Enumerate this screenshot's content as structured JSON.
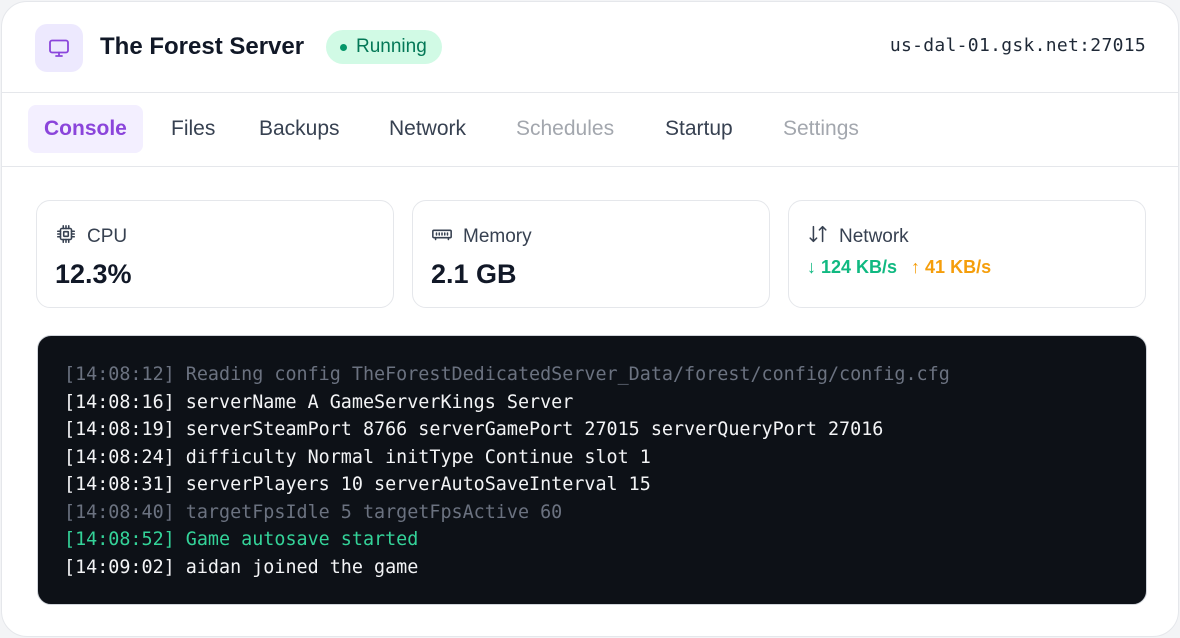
{
  "header": {
    "icon": "monitor-icon",
    "title": "The Forest Server",
    "status": "Running",
    "address": "us-dal-01.gsk.net:27015"
  },
  "tabs": [
    {
      "label": "Console",
      "state": "active"
    },
    {
      "label": "Files",
      "state": "normal"
    },
    {
      "label": "Backups",
      "state": "normal"
    },
    {
      "label": "Network",
      "state": "normal"
    },
    {
      "label": "Schedules",
      "state": "disabled"
    },
    {
      "label": "Startup",
      "state": "normal"
    },
    {
      "label": "Settings",
      "state": "disabled"
    }
  ],
  "stats": {
    "cpu": {
      "label": "CPU",
      "value": "12.3%",
      "icon": "cpu-icon"
    },
    "memory": {
      "label": "Memory",
      "value": "2.1 GB",
      "icon": "memory-icon"
    },
    "network": {
      "label": "Network",
      "icon": "arrows-up-down-icon",
      "down": "↓ 124 KB/s",
      "up": "↑ 41 KB/s"
    }
  },
  "console": {
    "lines": [
      {
        "text": "[14:08:12] Reading config TheForestDedicatedServer_Data/forest/config/config.cfg",
        "style": "dim"
      },
      {
        "text": "[14:08:16] serverName A GameServerKings Server",
        "style": "normal"
      },
      {
        "text": "[14:08:19] serverSteamPort 8766 serverGamePort 27015 serverQueryPort 27016",
        "style": "normal"
      },
      {
        "text": "[14:08:24] difficulty Normal initType Continue slot 1",
        "style": "normal"
      },
      {
        "text": "[14:08:31] serverPlayers 10 serverAutoSaveInterval 15",
        "style": "normal"
      },
      {
        "text": "[14:08:40] targetFpsIdle 5 targetFpsActive 60",
        "style": "dim"
      },
      {
        "text": "[14:08:52] Game autosave started",
        "style": "success"
      },
      {
        "text": "[14:09:02] aidan joined the game",
        "style": "normal"
      }
    ]
  },
  "colors": {
    "accent": "#8b45db",
    "status_bg": "#d1fae5",
    "status_text": "#047857",
    "console_bg": "#0d1117",
    "net_down": "#10b981",
    "net_up": "#f59e0b"
  }
}
